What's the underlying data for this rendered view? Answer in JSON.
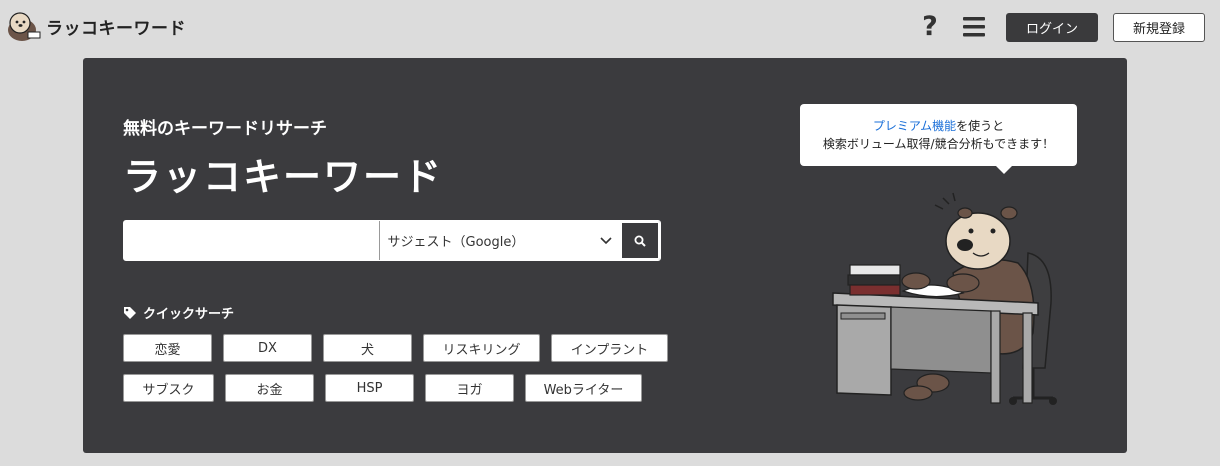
{
  "header": {
    "brand": "ラッコキーワード",
    "help_glyph": "?",
    "login_label": "ログイン",
    "signup_label": "新規登録"
  },
  "hero": {
    "subtitle": "無料のキーワードリサーチ",
    "title": "ラッコキーワード",
    "search": {
      "input_value": "",
      "placeholder": "",
      "mode_selected": "サジェスト（Google）"
    },
    "quick_search_label": "クイックサーチ",
    "quick_tags_row1": [
      "恋愛",
      "DX",
      "犬",
      "リスキリング",
      "インプラント"
    ],
    "quick_tags_row2": [
      "サブスク",
      "お金",
      "HSP",
      "ヨガ",
      "Webライター"
    ],
    "bubble": {
      "link_text": "プレミアム機能",
      "line1_rest": "を使うと",
      "line2": "検索ボリューム取得/競合分析もできます！"
    }
  },
  "colors": {
    "page_bg": "#dcdcdc",
    "hero_bg": "#3b3b3e",
    "link": "#1a6fd8"
  },
  "icons": [
    "otter-logo-icon",
    "help-icon",
    "hamburger-menu-icon",
    "chevron-down-icon",
    "search-icon",
    "tag-icon",
    "otter-illustration"
  ]
}
